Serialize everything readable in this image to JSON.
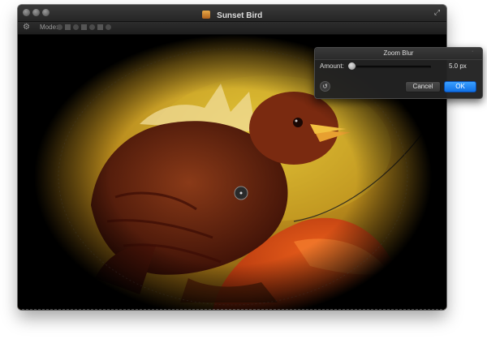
{
  "window": {
    "title": "Sunset Bird"
  },
  "toolbar": {
    "mode_label": "Mode:",
    "icons": [
      "gear-icon",
      "mode-icons"
    ]
  },
  "filter_panel": {
    "title": "Zoom Blur",
    "amount_label": "Amount:",
    "amount_value": "5.0 px",
    "slider_fraction": 0.0,
    "cancel_label": "Cancel",
    "ok_label": "OK"
  },
  "colors": {
    "accent_blue": "#1f86f5",
    "photo_orange": "#d9501c",
    "photo_yellow": "#e6c23a"
  }
}
